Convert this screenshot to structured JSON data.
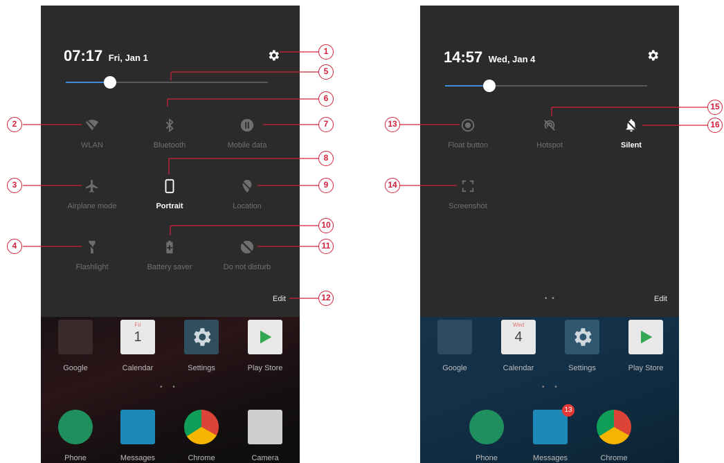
{
  "left": {
    "time": "07:17",
    "date": "Fri, Jan 1",
    "brightness_level": 0.22,
    "tiles": [
      {
        "label": "WLAN",
        "icon": "wifi-off-icon",
        "active": false
      },
      {
        "label": "Bluetooth",
        "icon": "bluetooth-icon",
        "active": false
      },
      {
        "label": "Mobile data",
        "icon": "mobile-data-icon",
        "active": false
      },
      {
        "label": "Airplane mode",
        "icon": "airplane-icon",
        "active": false
      },
      {
        "label": "Portrait",
        "icon": "portrait-icon",
        "active": true
      },
      {
        "label": "Location",
        "icon": "location-off-icon",
        "active": false
      },
      {
        "label": "Flashlight",
        "icon": "flashlight-icon",
        "active": false
      },
      {
        "label": "Battery saver",
        "icon": "battery-saver-icon",
        "active": false
      },
      {
        "label": "Do not disturb",
        "icon": "do-not-disturb-icon",
        "active": false
      }
    ],
    "edit_label": "Edit",
    "apps_row1": [
      "Google",
      "Calendar",
      "Settings",
      "Play Store"
    ],
    "calendar": {
      "weekday": "Fri",
      "day": "1"
    },
    "dock": [
      "Phone",
      "Messages",
      "Chrome",
      "Camera"
    ]
  },
  "right": {
    "time": "14:57",
    "date": "Wed, Jan 4",
    "brightness_level": 0.22,
    "tiles": [
      {
        "label": "Float button",
        "icon": "float-button-icon",
        "active": false
      },
      {
        "label": "Hotspot",
        "icon": "hotspot-icon",
        "active": false
      },
      {
        "label": "Silent",
        "icon": "silent-bell-icon",
        "active": true
      },
      {
        "label": "Screenshot",
        "icon": "screenshot-icon",
        "active": false
      }
    ],
    "page_dots": "• •",
    "edit_label": "Edit",
    "apps_row1": [
      "Google",
      "Calendar",
      "Settings",
      "Play Store"
    ],
    "calendar": {
      "weekday": "Wed",
      "day": "4"
    },
    "dock": [
      "Phone",
      "Messages",
      "Chrome"
    ],
    "messages_badge": "13"
  },
  "callouts": [
    "1",
    "2",
    "3",
    "4",
    "5",
    "6",
    "7",
    "8",
    "9",
    "10",
    "11",
    "12",
    "13",
    "14",
    "15",
    "16"
  ],
  "colors": {
    "accent": "#3d8bd9",
    "callout": "#d3203a",
    "shade": "#2b2b2b"
  }
}
